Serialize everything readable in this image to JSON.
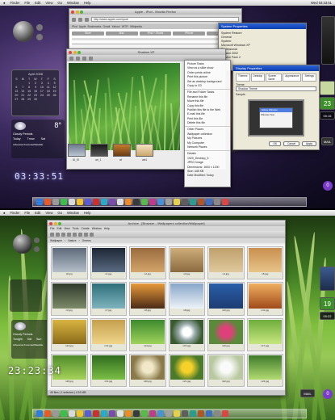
{
  "top": {
    "menubar": {
      "apple": "",
      "items": [
        "Finder",
        "File",
        "Edit",
        "View",
        "Go",
        "Window",
        "Help"
      ],
      "clock": "Wed 03:33:51"
    },
    "firefox": {
      "title": "Apple - iPod - Mozilla Firefox",
      "url": "http://www.apple.com/ipod/",
      "tabs": [
        "iPod",
        "Apple",
        "Bookmarks",
        "Gmail",
        "Yahoo!",
        "WTF!",
        "Wikipedia"
      ],
      "nav": [
        "Store",
        "Mac",
        "iPod + iTunes",
        "iPhone",
        "Downloads"
      ]
    },
    "system_properties": {
      "title": "System Properties",
      "tabs": [
        "System Restore",
        "Automatic Updates",
        "Remote",
        "General",
        "Computer Name",
        "Hardware",
        "Advanced"
      ],
      "lines": [
        "System:",
        "Microsoft Windows XP",
        "Professional",
        "Version 2002",
        "Service Pack 2"
      ]
    },
    "display_properties": {
      "title": "Display Properties",
      "tabs": [
        "Themes",
        "Desktop",
        "Screen Saver",
        "Appearance",
        "Settings"
      ],
      "theme_label": "Theme:",
      "theme_value": "Shadow Theme",
      "sample_label": "Sample:",
      "window_title": "Active Window",
      "window_text": "Window Text",
      "buttons": [
        "OK",
        "Cancel",
        "Apply"
      ]
    },
    "shadow_window": {
      "title": "Shadow XP"
    },
    "context_menu": [
      "Picture Tasks",
      "View as a slide show",
      "Order prints online",
      "Print this picture",
      "Set as desktop background",
      "Copy to CD",
      "File and Folder Tasks",
      "Rename this file",
      "Move this file",
      "Copy this file",
      "Publish this file to the Web",
      "E-mail this file",
      "Print this file",
      "Delete this file",
      "Other Places",
      "Wallpaper collection",
      "My Pictures",
      "My Computer",
      "Network Places",
      "Details",
      "1920_Desktop_5",
      "JPEG Image",
      "Dimensions: 1600 x 1200",
      "Size: 445 KB",
      "Date Modified: Today"
    ],
    "thumb_labels": [
      "AI_fX",
      "arl_1",
      "af",
      "ale1"
    ],
    "calendar": {
      "month": "April 2008",
      "weekdays": [
        "S",
        "M",
        "T",
        "W",
        "T",
        "F",
        "S"
      ],
      "days": [
        "",
        "",
        "1",
        "2",
        "3",
        "4",
        "5",
        "6",
        "7",
        "8",
        "9",
        "10",
        "11",
        "12",
        "13",
        "14",
        "15",
        "16",
        "17",
        "18",
        "19",
        "20",
        "21",
        "22",
        "23",
        "24",
        "25",
        "26",
        "27",
        "28",
        "29",
        "30",
        "",
        "",
        ""
      ]
    },
    "weather": {
      "temp": "8°",
      "city": "Cloudy Periods",
      "days": [
        "Today",
        "Tmrw",
        "Sat"
      ],
      "footer": "Advanced Forecast/Satellite"
    },
    "clock": "03:33:51",
    "right": {
      "day": "23",
      "time": "00:16",
      "count": "0",
      "label": "MAIL"
    }
  },
  "bottom": {
    "menubar": {
      "items": [
        "Finder",
        "File",
        "Edit",
        "View",
        "Go",
        "Window",
        "Help"
      ]
    },
    "browser": {
      "title": "Archive - [Browser - /Wallpapers collection/Wallpaper]",
      "menu": [
        "File",
        "Edit",
        "View",
        "Tools",
        "Create",
        "Window",
        "Help"
      ],
      "path": [
        "Wallpaper",
        "Nature",
        "Greens"
      ],
      "status": "45 files  |  1 selected  |  4.34 MB"
    },
    "thumbnails": [
      {
        "name": "iD.jpg",
        "kind": "sky"
      },
      {
        "name": "n1.jpg",
        "kind": "storm"
      },
      {
        "name": "n2.jpg",
        "kind": "dusk"
      },
      {
        "name": "n3.jpg",
        "kind": "sand"
      },
      {
        "name": "n4.jpg",
        "kind": "sand2"
      },
      {
        "name": "n5.jpg",
        "kind": "warm"
      },
      {
        "name": "n6.jpg",
        "kind": "forest"
      },
      {
        "name": "n7.jpg",
        "kind": "teal"
      },
      {
        "name": "n8.jpg",
        "kind": "sunset"
      },
      {
        "name": "n9.jpg",
        "kind": "clouds"
      },
      {
        "name": "n10.jpg",
        "kind": "blue"
      },
      {
        "name": "n11.jpg",
        "kind": "sunset2"
      },
      {
        "name": "n12.jpg",
        "kind": "wheat"
      },
      {
        "name": "n13.jpg",
        "kind": "wheat2"
      },
      {
        "name": "n14.jpg",
        "kind": "grass"
      },
      {
        "name": "n15.jpg",
        "kind": "dandelion"
      },
      {
        "name": "n16.jpg",
        "kind": "flower"
      },
      {
        "name": "n17.jpg",
        "kind": "grass2"
      },
      {
        "name": "n18.jpg",
        "kind": "grass3"
      },
      {
        "name": "n19.jpg",
        "kind": "grass4"
      },
      {
        "name": "n20.jpg",
        "kind": "seed"
      },
      {
        "name": "n21.jpg",
        "kind": "yellow"
      },
      {
        "name": "n22.jpg",
        "kind": "white"
      },
      {
        "name": "n23.jpg",
        "kind": "fern"
      }
    ],
    "weather": {
      "city": "Cloudy Periods",
      "days": [
        "Tonight",
        "Sat",
        "Sun"
      ],
      "footer": "Advanced Forecast/Satellite"
    },
    "clock": "23:23:34",
    "right": {
      "day": "19",
      "time": "00:22",
      "count": "0",
      "label": "MAIL"
    }
  },
  "colors": {
    "accent_blue": "#2a62d6",
    "mail_purple": "#7a3cc8",
    "day_green": "#3d8f2a"
  }
}
